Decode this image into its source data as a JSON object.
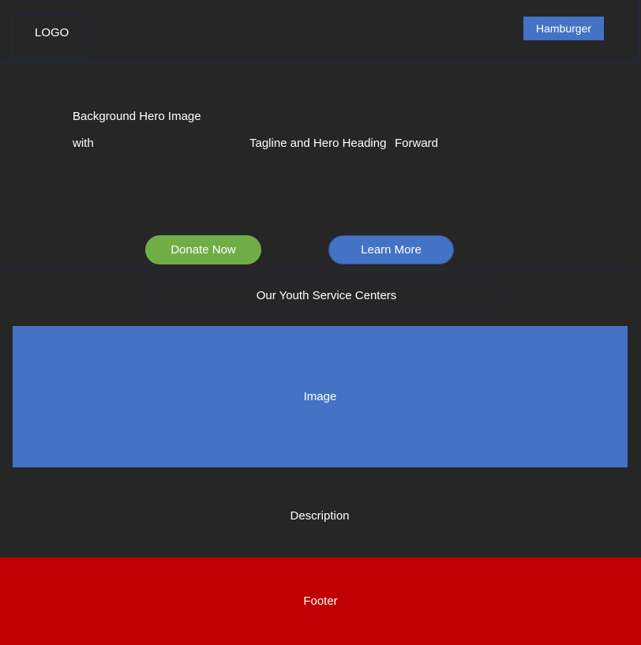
{
  "header": {
    "logo_label": "LOGO",
    "menu_button_label": "Hamburger"
  },
  "hero": {
    "line1": "Background Hero Image",
    "line2_left": "with",
    "line2_middle": "Tagline and Hero Heading",
    "line2_right": "Forward",
    "donate_label": "Donate Now",
    "learn_label": "Learn More"
  },
  "section": {
    "title": "Our Youth Service Centers",
    "image_label": "Image",
    "description_label": "Description"
  },
  "footer": {
    "label": "Footer"
  },
  "colors": {
    "background": "#262626",
    "primary_blue": "#4472c4",
    "donate_green": "#70ad47",
    "footer_red": "#c00000"
  }
}
